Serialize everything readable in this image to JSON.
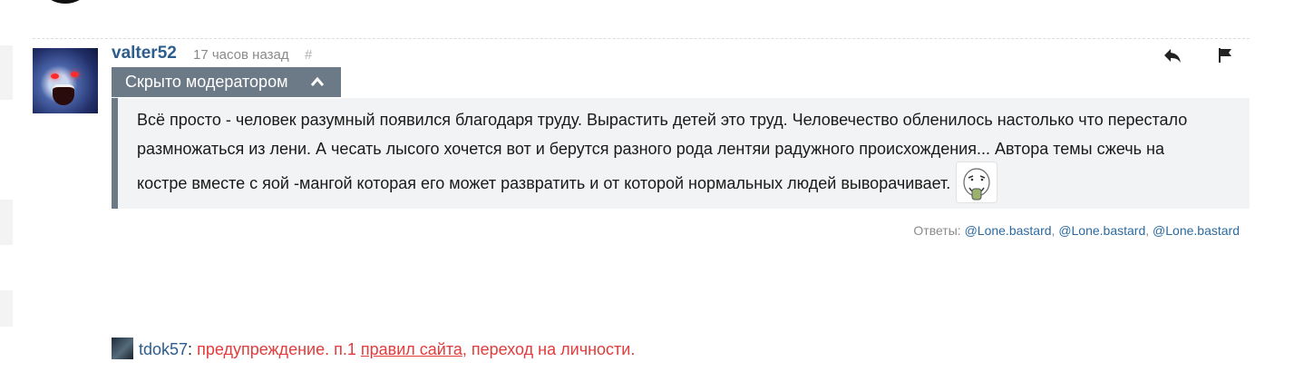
{
  "comment": {
    "author": "valter52",
    "time": "17 часов назад",
    "permalink": "#",
    "hidden_label": "Скрыто модератором",
    "text": "Всё просто - человек разумный появился благодаря труду. Вырастить детей это труд. Человечество обленилось настолько что перестало размножаться из лени. А чесать лысого хочется вот и берутся разного рода лентяи радужного происхождения... Автора темы сжечь на костре вместе с яой -мангой которая его может развратить и от которой нормальных людей выворачивает.",
    "replies_label": "Ответы:",
    "replies": [
      "@Lone.bastard",
      "@Lone.bastard",
      "@Lone.bastard"
    ],
    "icons": {
      "reply": "reply-icon",
      "report": "flag-icon",
      "collapse": "chevron-up-icon",
      "emoji": "troll-smiley-icon"
    }
  },
  "moderator_note": {
    "moderator": "tdok57",
    "colon": ":",
    "text_before": "предупреждение. п.1",
    "link_text": "правил сайта",
    "text_after": ", переход на личности."
  },
  "colors": {
    "link": "#2c5d8e",
    "hidden_bar": "#6c7986",
    "quote_bg": "#f1f3f4",
    "warning": "#e23c3c"
  }
}
